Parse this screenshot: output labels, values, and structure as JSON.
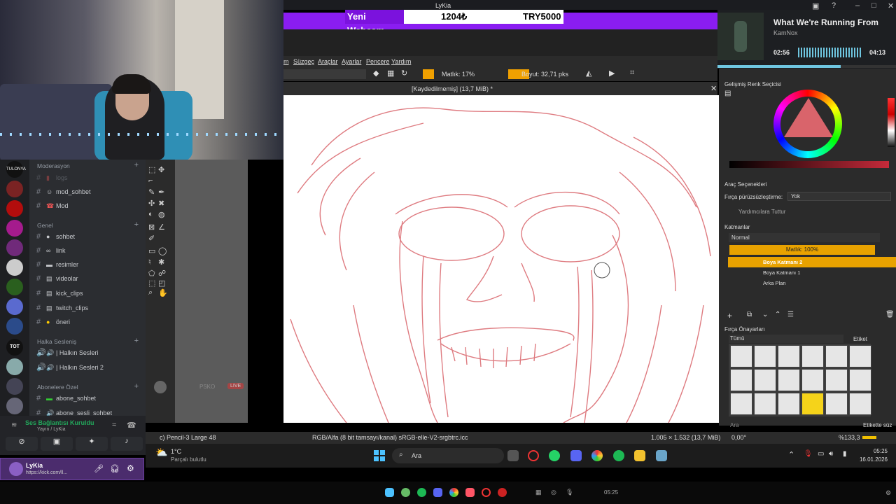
{
  "overlay": {
    "window_title": "LyKia",
    "webcam_label": "Yeni Webcam",
    "donation_value": "1204₺",
    "goal_value": "TRY5000"
  },
  "now_playing": {
    "title": "What We're Running From",
    "artist": "KamNox",
    "elapsed": "02:56",
    "duration": "04:13",
    "progress": 0.69
  },
  "krita": {
    "menu": [
      "m",
      "Süzgeç",
      "Araçlar",
      "Ayarlar",
      "Pencere",
      "Yardım"
    ],
    "opacity_label": "Matlık: 17%",
    "size_label": "Boyut: 32,71 pks",
    "doc_title": "[Kaydedilmemiş] (13,7 MiB) *",
    "status_brush": "c) Pencil-3 Large 48",
    "status_color": "RGB/Alfa (8 bit tamsayı/kanal) sRGB-elle-V2-srgbtrc.icc",
    "status_size": "1.005 × 1.532 (13,7 MiB)",
    "status_rotation": "0,00°",
    "status_zoom": "%133,3"
  },
  "right_panel": {
    "color_selector": "Gelişmiş Renk Seçicisi",
    "tool_options": "Araç Seçenekleri",
    "smoothing_label": "Fırça pürüzsüzleştirme:",
    "smoothing_value": "Yok",
    "assistants": "Yardımcılara Tuttur",
    "layers_title": "Katmanlar",
    "blend_mode": "Normal",
    "layer_opacity": "Matlık: 100%",
    "layers": [
      "Boya Katmanı 2",
      "Boya Katmanı 1",
      "Arka Plan"
    ],
    "presets_title": "Fırça Önayarları",
    "presets_filter": "Tümü",
    "presets_tag": "Etiket",
    "search_placeholder": "Ara",
    "tag_filter": "Etikette süz"
  },
  "discord": {
    "categories": {
      "moderation": "Moderasyon",
      "general": "Genel",
      "voice": "Halka Sesleniş",
      "subscribers": "Abonelere Özel"
    },
    "mod_channels": [
      "logs",
      "mod_sohbet",
      "Mod"
    ],
    "general_channels": [
      "sohbet",
      "link",
      "resimler",
      "videolar",
      "kick_clips",
      "twitch_clips",
      "öneri"
    ],
    "voice_channels": [
      "| Halkın Sesleri",
      "| Halkın Sesleri 2"
    ],
    "sub_channels": [
      "abone_sohbet",
      "abone_sesli_sohbet"
    ],
    "voice_status": "Ses Bağlantısı Kuruldu",
    "voice_channel": "Yayın / LyKia",
    "user_name": "LyKia",
    "user_status": "https://kick.com/ll...",
    "live_badge": "LIVE",
    "stream_tag": "PSKO"
  },
  "taskbar": {
    "weather_temp": "1°C",
    "weather_desc": "Parçalı bulutlu",
    "search_label": "Ara",
    "time": "05:25",
    "date": "16.01.2026",
    "bottom_time": "05:25"
  }
}
